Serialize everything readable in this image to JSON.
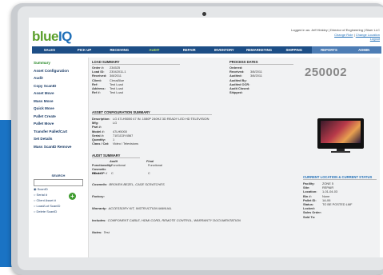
{
  "app": {
    "logo_part1": "blue",
    "logo_part2": "IQ",
    "account_line": "Logged in as: Jeff Hinkley | Director of Engineering | Bluer LLC",
    "links": [
      "Change Role",
      "Change Location",
      "Logout"
    ]
  },
  "nav": [
    "SALES",
    "PICK UP",
    "RECEIVING",
    "AUDIT",
    "REPAIR",
    "INVENTORY",
    "REMARKETING",
    "SHIPPING",
    "REPORTS",
    "ADMIN"
  ],
  "sidebar": {
    "items": [
      "Summary",
      "Asset Configuration",
      "Audit",
      "Copy ScanID",
      "Asset Move",
      "Mass Move",
      "Quick Move",
      "Pallet Create",
      "Pallet Move",
      "Transfer Pallet/Cart",
      "Set Details",
      "Mass ScanID Remove"
    ],
    "search": {
      "title": "SEARCH",
      "options": [
        "ScanID",
        "Serial #",
        "Client Asset #",
        "Load/Lot ScanID",
        "Delete ScanID"
      ]
    }
  },
  "load_summary": {
    "title": "LOAD SUMMARY",
    "rows": [
      {
        "k": "Order #:",
        "v": "234525"
      },
      {
        "k": "Load ID:",
        "v": "23042011-1"
      },
      {
        "k": "Received:",
        "v": "3/8/2011"
      },
      {
        "k": "Client:",
        "v": "CirrusBlue"
      },
      {
        "k": "Ref:",
        "v": "Test Load"
      },
      {
        "k": "Address:",
        "v": "Test Load"
      },
      {
        "k": "Ref #:",
        "v": "Test Load"
      }
    ]
  },
  "process_dates": {
    "title": "PROCESS DATES",
    "rows": [
      {
        "k": "Ordered:",
        "v": ""
      },
      {
        "k": "Received:",
        "v": "3/8/2011"
      },
      {
        "k": "Audited:",
        "v": "3/8/2011"
      },
      {
        "k": "Audited By:",
        "v": ""
      },
      {
        "k": "Audited OCR:",
        "v": ""
      },
      {
        "k": "Audit Closed:",
        "v": ""
      },
      {
        "k": "Shipped:",
        "v": ""
      }
    ]
  },
  "asset_id": "250002",
  "asset_config": {
    "title": "ASSET CONFIGURATION SUMMARY",
    "rows": [
      {
        "k": "Description:",
        "v": "LG 47LH5000 47 IN. 1080P 240HZ 3D READY LED HD TELEVISION"
      },
      {
        "k": "Mfg:",
        "v": "LG"
      },
      {
        "k": "Part #:",
        "v": ""
      },
      {
        "k": "Model #:",
        "v": "47LH5000"
      },
      {
        "k": "Serial #:",
        "v": "71E1D3Y4567"
      },
      {
        "k": "Quantity:",
        "v": "1"
      },
      {
        "k": "Class / Cat:",
        "v": "Video / Televisions"
      }
    ]
  },
  "audit_summary": {
    "title": "AUDIT SUMMARY",
    "col_audit": "Audit",
    "col_final": "Final",
    "functionality_label": "Functionality:",
    "functionality_audit": "Functional",
    "functionality_final": "Functional",
    "grade_label": "Cosmetic Grade:",
    "grade_audit": "C",
    "grade_final": "C",
    "hd_label": "HD: /  OP: /",
    "cosmetic_label": "Cosmetic:",
    "cosmetic_value": "BROKEN BEZEL, CASE SCRATCHES",
    "factory_label": "Factory:",
    "factory_value": "",
    "warranty_label": "Warranty:",
    "warranty_value": "ACCESSORY KIT, INSTRUCTION MANUAL",
    "includes_label": "Includes:",
    "includes_value": "COMPONENT CABLE, HDMI CORD, REMOTE CONTROL, WARRANTY DOCUMENTATION",
    "notes_label": "Notes:",
    "notes_value": "Test"
  },
  "current_location": {
    "title": "CURRENT LOCATION & CURRENT STATUS",
    "rows": [
      {
        "k": "Facility:",
        "v": "ZONE 5"
      },
      {
        "k": "Site:",
        "v": "REPAIR"
      },
      {
        "k": "Location:",
        "v": "1-01-04-03"
      },
      {
        "k": "Bin #:",
        "v": "None"
      },
      {
        "k": "Pallet ID:",
        "v": "1A-06"
      },
      {
        "k": "Status:",
        "v": "TO BE POSTED LMF"
      },
      {
        "k": "Locked:",
        "v": ""
      },
      {
        "k": "Sales Order:",
        "v": ""
      },
      {
        "k": "Sold To:",
        "v": ""
      }
    ]
  },
  "colors": {
    "nav_bg": "#1d4e86",
    "accent_green": "#5b9f2b",
    "brand_blue": "#1f6fb8"
  }
}
